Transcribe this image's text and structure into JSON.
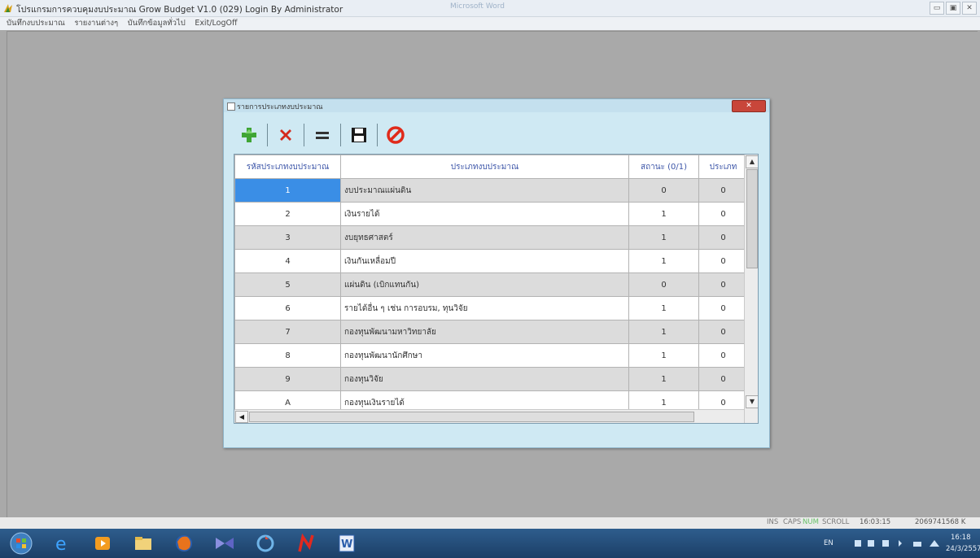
{
  "window": {
    "title": "โปรแกรมการควบคุมงบประมาณ Grow Budget V1.0 (029) Login By Administrator",
    "center_tab": "Microsoft Word",
    "controls": [
      "▭",
      "▣",
      "✕"
    ]
  },
  "menu": {
    "items": [
      "บันทึกงบประมาณ",
      "รายงานต่างๆ",
      "บันทึกข้อมูลทั่วไป",
      "Exit/LogOff"
    ]
  },
  "dialog": {
    "title": "รายการประเภทงบประมาณ",
    "close_label": "✕",
    "toolbar": [
      "add-icon",
      "delete-icon",
      "edit-icon",
      "save-icon",
      "cancel-icon"
    ]
  },
  "grid": {
    "columns": [
      "รหัสประเภทงบประมาณ",
      "ประเภทงบประมาณ",
      "สถานะ (0/1)",
      "ประเภท"
    ],
    "rows": [
      {
        "code": "1",
        "name": "งบประมาณแผ่นดิน",
        "status": "0",
        "type": "0"
      },
      {
        "code": "2",
        "name": "เงินรายได้",
        "status": "1",
        "type": "0"
      },
      {
        "code": "3",
        "name": "งบยุทธศาสตร์",
        "status": "1",
        "type": "0"
      },
      {
        "code": "4",
        "name": "เงินกันเหลื่อมปี",
        "status": "1",
        "type": "0"
      },
      {
        "code": "5",
        "name": "แผ่นดิน (เบิกแทนกัน)",
        "status": "0",
        "type": "0"
      },
      {
        "code": "6",
        "name": "รายได้อื่น ๆ เช่น การอบรม, ทุนวิจัย",
        "status": "1",
        "type": "0"
      },
      {
        "code": "7",
        "name": "กองทุนพัฒนามหาวิทยาลัย",
        "status": "1",
        "type": "0"
      },
      {
        "code": "8",
        "name": "กองทุนพัฒนานักศึกษา",
        "status": "1",
        "type": "0"
      },
      {
        "code": "9",
        "name": "กองทุนวิจัย",
        "status": "1",
        "type": "0"
      },
      {
        "code": "A",
        "name": "กองทุนเงินรายได้",
        "status": "1",
        "type": "0"
      }
    ]
  },
  "status_bar": {
    "ins": "INS",
    "caps": "CAPS",
    "num": "NUM",
    "scroll": "SCROLL",
    "time": "16:03:15",
    "value": "2069741568 K"
  },
  "taskbar": {
    "lang": "EN",
    "clock_time": "16:18",
    "clock_date": "24/3/2557"
  }
}
